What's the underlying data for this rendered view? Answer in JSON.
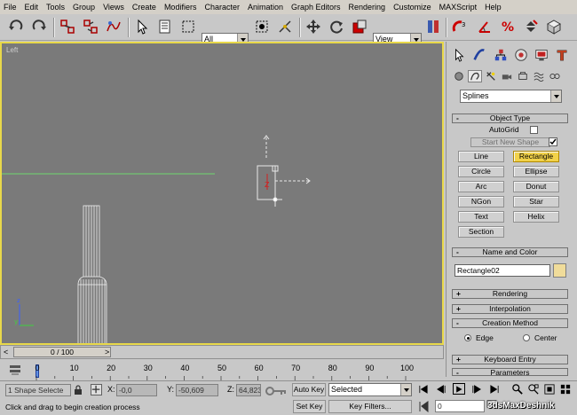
{
  "menubar": {
    "items": [
      "File",
      "Edit",
      "Tools",
      "Group",
      "Views",
      "Create",
      "Modifiers",
      "Character",
      "Animation",
      "Graph Editors",
      "Rendering",
      "Customize",
      "MAXScript",
      "Help"
    ]
  },
  "toolbar": {
    "selection_filter": "All",
    "reference_coord": "View"
  },
  "viewport": {
    "label": "Left"
  },
  "command_panel": {
    "category_dropdown": "Splines",
    "object_type": {
      "title": "Object Type",
      "autogrid_label": "AutoGrid",
      "start_new_shape_label": "Start New Shape",
      "buttons": [
        "Line",
        "Rectangle",
        "Circle",
        "Ellipse",
        "Arc",
        "Donut",
        "NGon",
        "Star",
        "Text",
        "Helix",
        "Section"
      ],
      "active": "Rectangle"
    },
    "name_and_color": {
      "title": "Name and Color",
      "object_name": "Rectangle02",
      "swatch_color": "#f0dc9a"
    },
    "rollouts": {
      "rendering": "Rendering",
      "interpolation": "Interpolation",
      "creation_method": "Creation Method",
      "keyboard_entry": "Keyboard Entry",
      "parameters": "Parameters"
    },
    "creation_method": {
      "edge_label": "Edge",
      "center_label": "Center",
      "selected": "Edge"
    }
  },
  "timeline": {
    "frame_display": "0 / 100",
    "ticks": [
      "0",
      "10",
      "20",
      "30",
      "40",
      "50",
      "60",
      "70",
      "80",
      "90",
      "100"
    ]
  },
  "status": {
    "selection_text": "1 Shape Selecte",
    "x_label": "X:",
    "x_value": "-0,0",
    "y_label": "Y:",
    "y_value": "-50,609",
    "z_label": "Z:",
    "z_value": "64,823",
    "prompt": "Click and drag to begin creation process",
    "auto_key": "Auto Key",
    "set_key": "Set Key",
    "key_mode": "Selected",
    "key_filters": "Key Filters...",
    "current_frame": "0"
  },
  "watermark": "3dsMaxDeshnik",
  "colors": {
    "viewport_bg": "#7a7a7a",
    "viewport_border": "#e8d84a",
    "active_button": "#f2d24a",
    "ui_bg": "#c8c8c8"
  }
}
